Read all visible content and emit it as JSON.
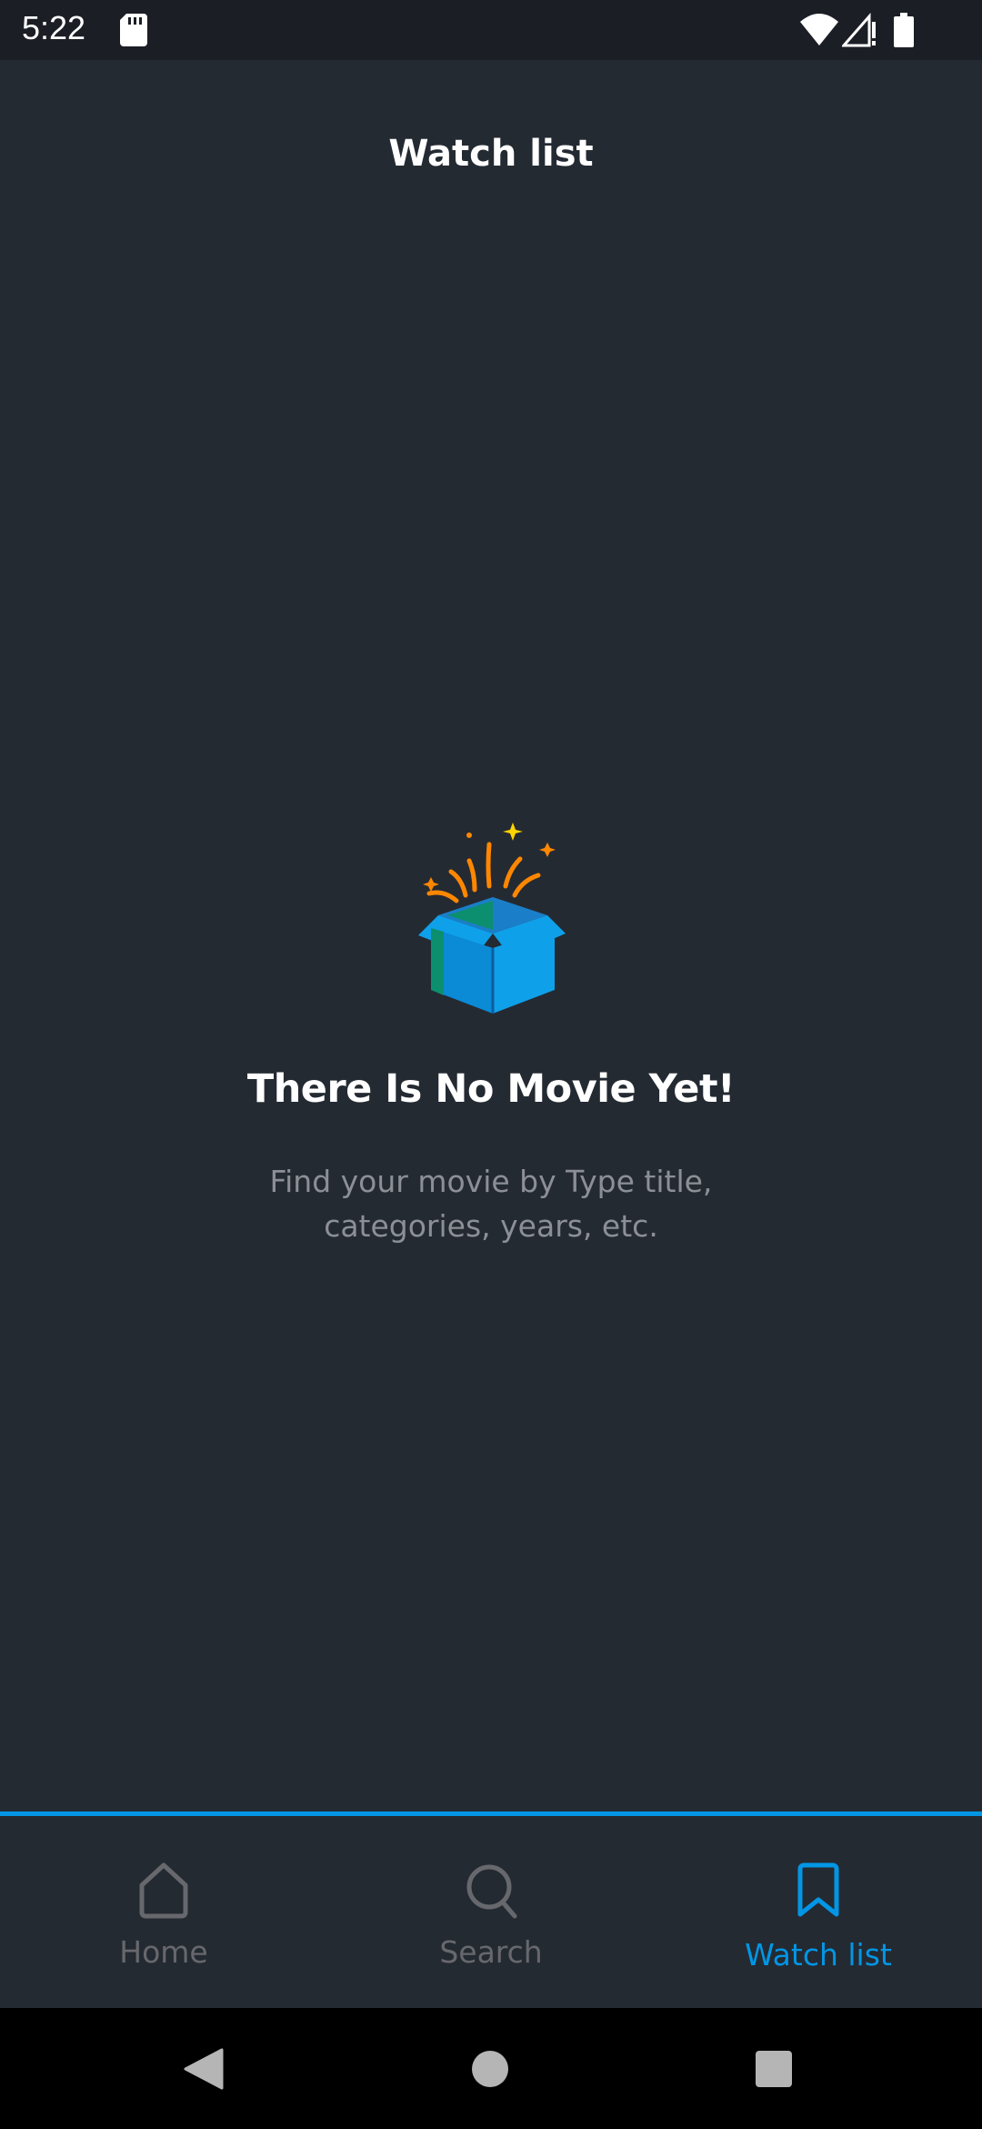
{
  "status_bar": {
    "time": "5:22",
    "icons": [
      "sd-card-icon",
      "wifi-icon",
      "signal-icon",
      "battery-icon"
    ]
  },
  "header": {
    "title": "Watch list"
  },
  "empty_state": {
    "icon": "open-box-icon",
    "title": "There Is No Movie Yet!",
    "subtitle": "Find your movie by Type title, categories, years, etc."
  },
  "bottom_nav": {
    "items": [
      {
        "label": "Home",
        "icon": "home-icon",
        "active": false
      },
      {
        "label": "Search",
        "icon": "search-icon",
        "active": false
      },
      {
        "label": "Watch list",
        "icon": "bookmark-icon",
        "active": true
      }
    ]
  },
  "system_nav": {
    "buttons": [
      "back-icon",
      "home-circle-icon",
      "recents-icon"
    ]
  },
  "colors": {
    "background": "#242a32",
    "status_bar": "#1c1e26",
    "accent": "#0296e5",
    "inactive": "#67686d",
    "subtitle": "#8d8f97",
    "box_orange": "#ff8700"
  }
}
